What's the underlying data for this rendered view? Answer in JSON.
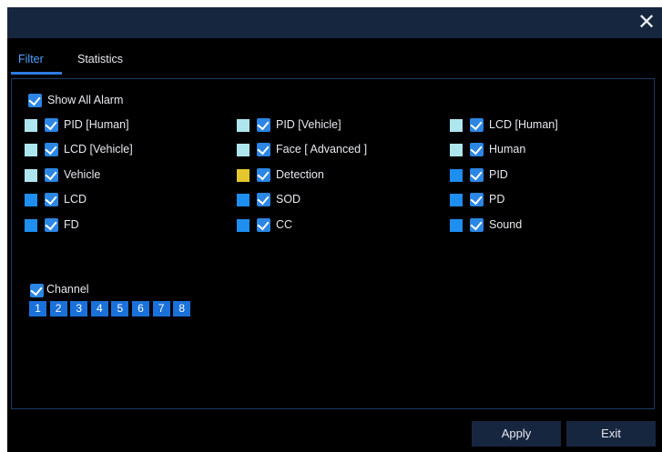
{
  "window": {
    "close_glyph": "✕"
  },
  "tabs": [
    {
      "label": "Filter",
      "active": true
    },
    {
      "label": "Statistics",
      "active": false
    }
  ],
  "show_all": {
    "label": "Show All Alarm",
    "checked": true
  },
  "alarm_types": [
    {
      "label": "PID [Human]",
      "color": "#aee6f0",
      "checked": true
    },
    {
      "label": "PID [Vehicle]",
      "color": "#aee6f0",
      "checked": true
    },
    {
      "label": "LCD [Human]",
      "color": "#aee6f0",
      "checked": true
    },
    {
      "label": "LCD [Vehicle]",
      "color": "#aee6f0",
      "checked": true
    },
    {
      "label": "Face   [ Advanced ]",
      "color": "#aee6f0",
      "checked": true
    },
    {
      "label": "Human",
      "color": "#aee6f0",
      "checked": true
    },
    {
      "label": "Vehicle",
      "color": "#aee6f0",
      "checked": true
    },
    {
      "label": "Detection",
      "color": "#e3c72d",
      "checked": true
    },
    {
      "label": "PID",
      "color": "#1e8ef0",
      "checked": true
    },
    {
      "label": "LCD",
      "color": "#1e8ef0",
      "checked": true
    },
    {
      "label": "SOD",
      "color": "#1e8ef0",
      "checked": true
    },
    {
      "label": "PD",
      "color": "#1e8ef0",
      "checked": true
    },
    {
      "label": "FD",
      "color": "#1e8ef0",
      "checked": true
    },
    {
      "label": "CC",
      "color": "#1e8ef0",
      "checked": true
    },
    {
      "label": "Sound",
      "color": "#1e8ef0",
      "checked": true
    }
  ],
  "channel": {
    "label": "Channel",
    "checked": true,
    "numbers": [
      "1",
      "2",
      "3",
      "4",
      "5",
      "6",
      "7",
      "8"
    ]
  },
  "buttons": {
    "apply": "Apply",
    "exit": "Exit"
  },
  "colors": {
    "accent": "#2b86e4",
    "titlebar": "#17263f",
    "border": "#1d3a63"
  }
}
